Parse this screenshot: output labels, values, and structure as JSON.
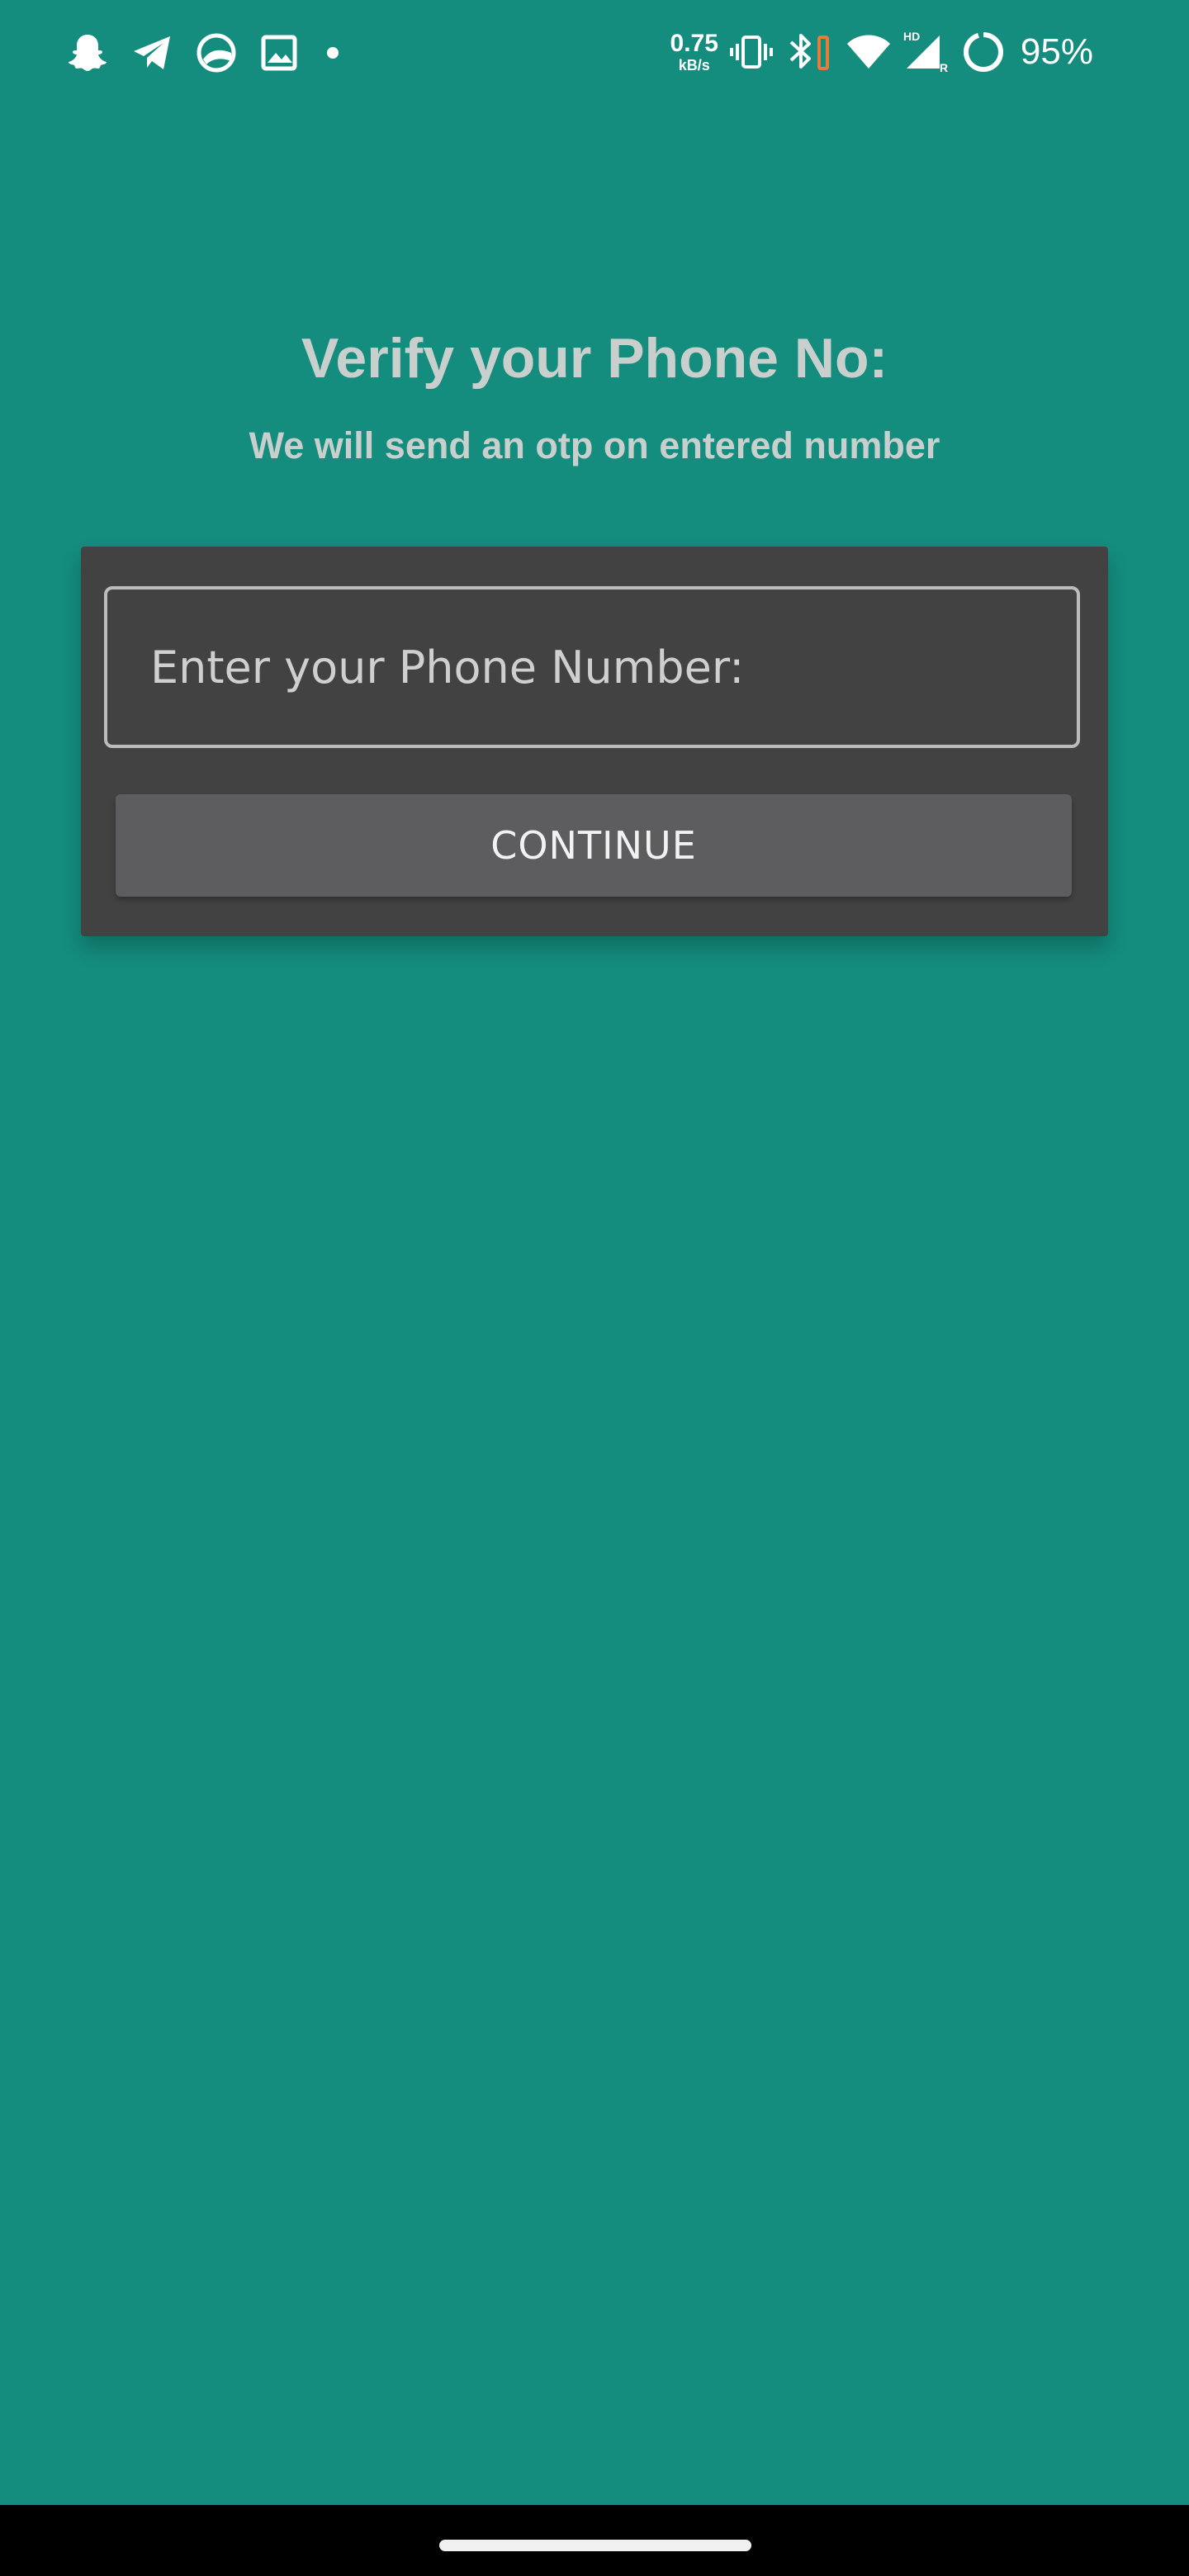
{
  "status_bar": {
    "net_speed_value": "0.75",
    "net_speed_unit": "kB/s",
    "battery_percent": "95%",
    "notification_icons": [
      "snapchat-icon",
      "telegram-icon",
      "sync-app-icon",
      "gallery-icon",
      "notification-dot-icon"
    ],
    "system_icons": [
      "vibrate-icon",
      "bluetooth-icon",
      "wifi-icon",
      "signal-hd-icon",
      "battery-ring-icon"
    ]
  },
  "screen": {
    "title": "Verify your Phone No:",
    "subtitle": "We will send an otp on entered number"
  },
  "form": {
    "phone_placeholder": "Enter your Phone Number:",
    "phone_value": "",
    "continue_label": "CONTINUE"
  },
  "colors": {
    "background": "#148c7e",
    "card": "#424242",
    "button": "#5d5d5f",
    "heading_text": "#c8cfcc",
    "bluetooth_battery_accent": "#e87a3a"
  }
}
